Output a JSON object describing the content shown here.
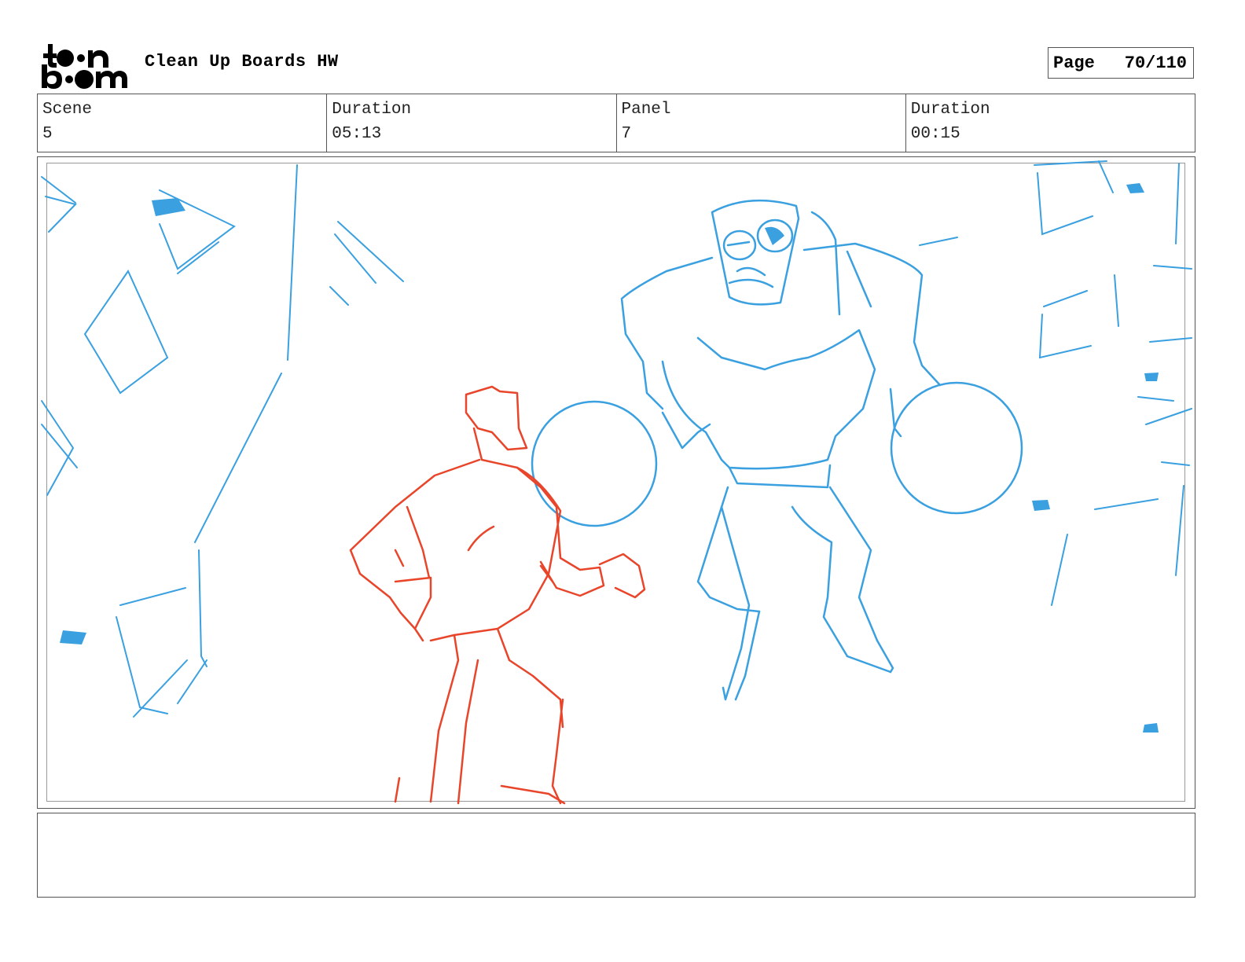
{
  "header": {
    "logo": {
      "icon": "toonboom-logo",
      "line1": "toon",
      "line2": "boom"
    },
    "title": "Clean Up Boards HW",
    "page_label": "Page",
    "page_value": "70/110"
  },
  "info": {
    "scene_label": "Scene",
    "scene_value": "5",
    "scene_duration_label": "Duration",
    "scene_duration_value": "05:13",
    "panel_label": "Panel",
    "panel_value": "7",
    "panel_duration_label": "Duration",
    "panel_duration_value": "00:15"
  },
  "panel_image": {
    "content": "rough storyboard sketch",
    "colors": {
      "hero": "#e8452a",
      "robot": "#3aa0e0",
      "background": "#3aa0e0"
    }
  },
  "notes": {
    "text": ""
  }
}
